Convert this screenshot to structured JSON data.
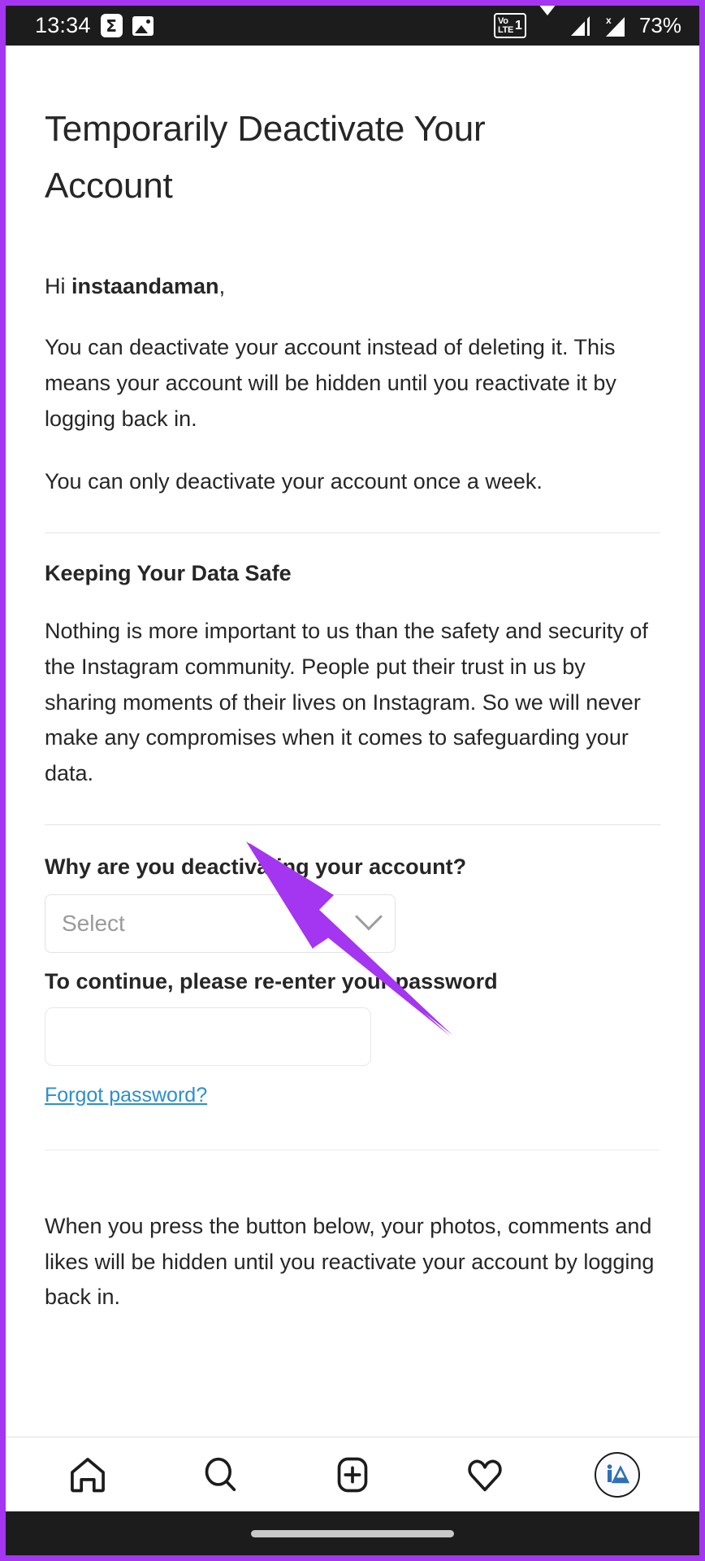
{
  "status_bar": {
    "time": "13:34",
    "battery": "73%",
    "icons": [
      "sigma-icon",
      "photo-icon",
      "volte-icon",
      "wifi-icon",
      "signal-icon",
      "signal-no-sim-icon"
    ],
    "volte_label_top": "Vo",
    "volte_label_bottom": "LTE",
    "volte_sim": "1",
    "signal_x": "x"
  },
  "page": {
    "title": "Temporarily Deactivate Your Account",
    "greeting_prefix": "Hi ",
    "username": "instaandaman",
    "greeting_suffix": ",",
    "paragraph_1": "You can deactivate your account instead of deleting it. This means your account will be hidden until you reactivate it by logging back in.",
    "paragraph_2": "You can only deactivate your account once a week.",
    "section_heading": "Keeping Your Data Safe",
    "paragraph_3": "Nothing is more important to us than the safety and security of the Instagram community. People put their trust in us by sharing moments of their lives on Instagram. So we will never make any compromises when it comes to safeguarding your data.",
    "reason_label": "Why are you deactivating your account?",
    "reason_value": "Select",
    "password_label": "To continue, please re-enter your password",
    "password_value": "",
    "forgot_link": "Forgot password?",
    "bottom_paragraph": "When you press the button below, your photos, comments and likes will be hidden until you reactivate your account by logging back in."
  },
  "colors": {
    "accent_purple": "#a435f0",
    "link_blue": "#2a8fd0",
    "text": "#262626",
    "placeholder": "#9a9a9a",
    "border": "#e2e2e2",
    "avatar_blue": "#2f6fb5"
  },
  "bottom_nav": {
    "items": [
      {
        "name": "home-icon",
        "label": "Home"
      },
      {
        "name": "search-icon",
        "label": "Search"
      },
      {
        "name": "add-post-icon",
        "label": "New post"
      },
      {
        "name": "heart-icon",
        "label": "Activity"
      },
      {
        "name": "profile-avatar",
        "label": "iA"
      }
    ]
  },
  "annotation": {
    "type": "arrow",
    "color": "#a435f0",
    "points_to": "reason-select"
  }
}
